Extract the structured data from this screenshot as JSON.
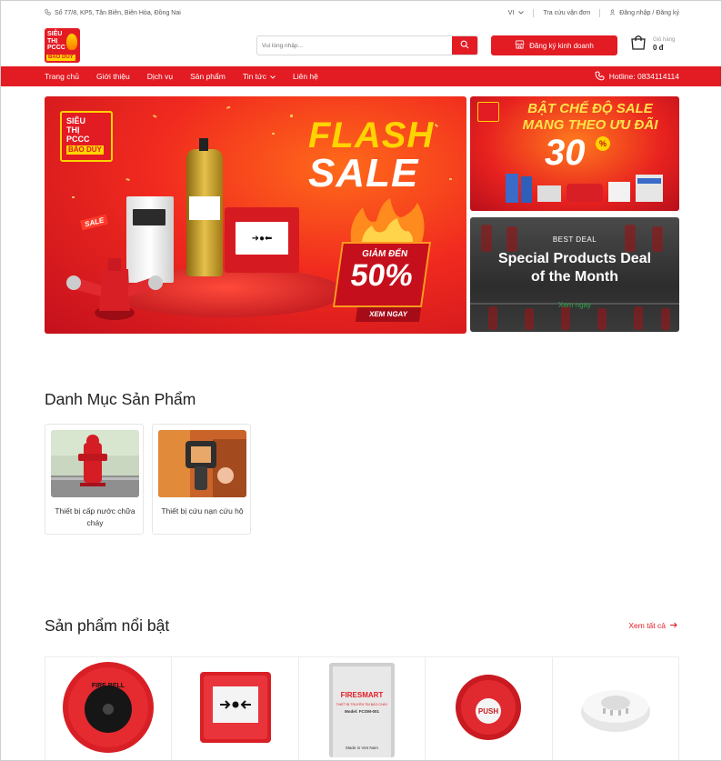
{
  "topbar": {
    "address": "Số 77/8, KP5, Tân Biên, Biên Hòa, Đồng Nai",
    "language": "VI",
    "order_lookup": "Tra cứu vận đơn",
    "login": "Đăng nhập / Đăng ký"
  },
  "header": {
    "logo_lines": [
      "SIÊU",
      "THỊ",
      "PCCC"
    ],
    "logo_brand": "BẢO DUY",
    "search_placeholder": "Vui lòng nhập...",
    "register_label": "Đăng ký kinh doanh",
    "cart_label": "Giỏ hàng",
    "cart_amount": "0 đ"
  },
  "nav": {
    "items": [
      {
        "label": "Trang chủ"
      },
      {
        "label": "Giới thiệu"
      },
      {
        "label": "Dịch vụ"
      },
      {
        "label": "Sản phẩm"
      },
      {
        "label": "Tin tức"
      },
      {
        "label": "Liên hệ"
      }
    ],
    "hotline": "Hotline: 0834114114"
  },
  "banners": {
    "main": {
      "logo_lines": [
        "SIÊU",
        "THỊ",
        "PCCC"
      ],
      "logo_brand": "BẢO DUY",
      "flash": "FLASH",
      "sale": "SALE",
      "sale_tag": "SALE",
      "discount_label": "GIẢM ĐẾN",
      "discount_value": "50%",
      "cta": "XEM NGAY"
    },
    "side1": {
      "title_line1": "BẬT CHẾ ĐỘ SALE",
      "title_line2": "MANG THEO ƯU ĐÃI",
      "percent": "30",
      "pct_sign": "%"
    },
    "side2": {
      "eyebrow": "BEST DEAL",
      "title_line1": "Special Products Deal",
      "title_line2": "of the Month",
      "cta": "Xem ngay"
    }
  },
  "categories": {
    "title": "Danh Mục Sản Phẩm",
    "items": [
      {
        "label": "Thiết bị cấp nước chữa cháy"
      },
      {
        "label": "Thiết bị cứu nạn cứu hộ"
      }
    ]
  },
  "featured": {
    "title": "Sản phẩm nổi bật",
    "see_all": "Xem tất cả",
    "products": [
      {
        "icon": "fire-bell",
        "label": "FIRE BELL"
      },
      {
        "icon": "manual-call-point",
        "label": ""
      },
      {
        "icon": "firesmart-module",
        "brand": "FIRESMART",
        "label": "THIẾT BỊ TRUYỀN TIN BÁO CHÁY",
        "model": "Model: FCOM-001",
        "origin": "Made in Viet Nam"
      },
      {
        "icon": "push-button",
        "label": "PUSH"
      },
      {
        "icon": "smoke-detector",
        "label": ""
      }
    ]
  },
  "colors": {
    "brand_red": "#e31b23",
    "accent_yellow": "#ffd400",
    "link_green": "#2fa34a"
  }
}
